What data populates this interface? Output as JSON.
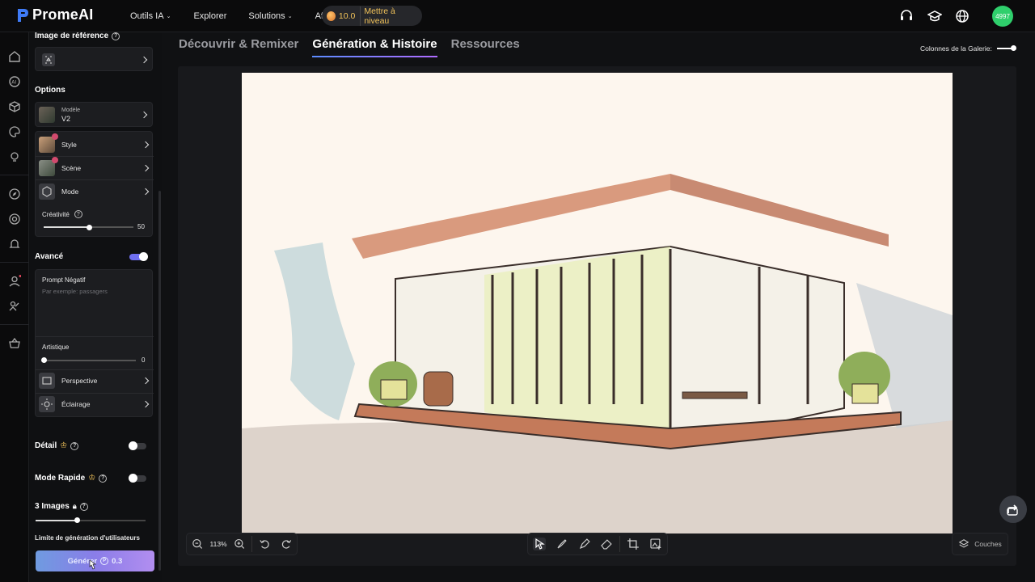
{
  "app": {
    "name": "PromeAI"
  },
  "nav": [
    {
      "label": "Outils IA",
      "dropdown": true
    },
    {
      "label": "Explorer",
      "dropdown": false
    },
    {
      "label": "Solutions",
      "dropdown": true
    },
    {
      "label": "Affilié",
      "dropdown": false
    }
  ],
  "credits": {
    "value": "10.0",
    "upgrade_label": "Mettre à niveau"
  },
  "user": {
    "avatar_label": "4997"
  },
  "panel": {
    "reference": {
      "title": "Image de référence"
    },
    "options": {
      "title": "Options",
      "model_label": "Modèle",
      "model_value": "V2",
      "style_label": "Style",
      "scene_label": "Scène",
      "mode_label": "Mode",
      "creativity_label": "Créativité",
      "creativity_value": 50
    },
    "advanced": {
      "title": "Avancé",
      "enabled": true,
      "negative_prompt_label": "Prompt Négatif",
      "negative_prompt_placeholder": "Par exemple: passagers",
      "artistic_label": "Artistique",
      "artistic_value": 0,
      "perspective_label": "Perspective",
      "lighting_label": "Éclairage"
    },
    "detail": {
      "label": "Détail",
      "enabled": false
    },
    "fast_mode": {
      "label": "Mode Rapide",
      "enabled": false
    },
    "images": {
      "label": "3 Images",
      "count": 3,
      "max": 4
    },
    "limit_label": "Limite de génération d'utilisateurs",
    "generate": {
      "label": "Générer",
      "cost": "0.3"
    }
  },
  "tabs": [
    {
      "label": "Découvrir & Remixer",
      "active": false
    },
    {
      "label": "Génération & Histoire",
      "active": true
    },
    {
      "label": "Ressources",
      "active": false
    }
  ],
  "gallery_columns_label": "Colonnes de la Galerie:",
  "canvas": {
    "zoom": "113%",
    "layers_label": "Couches"
  },
  "colors": {
    "accent": "#6f6ff0",
    "credits": "#f2c35a",
    "avatar": "#2fcf6c",
    "bg": "#0f1012"
  }
}
